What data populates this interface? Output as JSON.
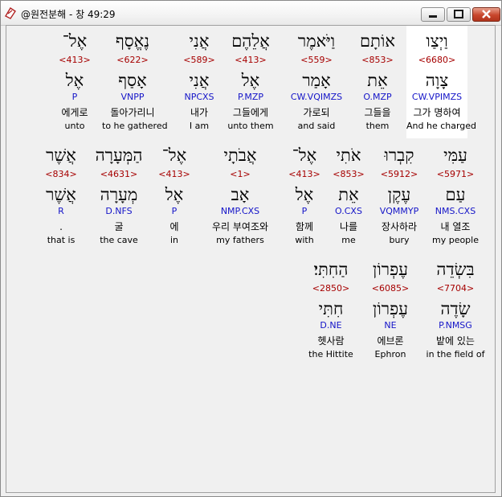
{
  "window": {
    "title": "@원전분해 - 창 49:29",
    "buttons": {
      "minimize": "minimize-icon",
      "maximize": "maximize-icon",
      "close": "close-icon"
    },
    "close_color": "#c8462c"
  },
  "colors": {
    "strongs": "#a60000",
    "parsing": "#1414c8",
    "selected_bg": "#ffffff",
    "panel_bg": "#f0f0f0"
  },
  "rows": [
    {
      "words": [
        {
          "hebrew": "וַיְצַו",
          "strongs": "<6680>",
          "lemma": "צָוָה",
          "parse": "CW.VPIMZS",
          "korean": "그가 명하여",
          "english": "And he charged",
          "selected": true
        },
        {
          "hebrew": "אוֹתָם",
          "strongs": "<853>",
          "lemma": "אֵת",
          "parse": "O.MZP",
          "korean": "그들을",
          "english": "them"
        },
        {
          "hebrew": "וַיֹּאמֶר",
          "strongs": "<559>",
          "lemma": "אָמַר",
          "parse": "CW.VQIMZS",
          "korean": "가로되",
          "english": "and said"
        },
        {
          "hebrew": "אֲלֵהֶם",
          "strongs": "<413>",
          "lemma": "אֶל",
          "parse": "P.MZP",
          "korean": "그들에게",
          "english": "unto them"
        },
        {
          "hebrew": "אֲנִי",
          "strongs": "<589>",
          "lemma": "אֲנִי",
          "parse": "NPCXS",
          "korean": "내가",
          "english": "I am"
        },
        {
          "hebrew": "נֶאֱסָף",
          "strongs": "<622>",
          "lemma": "אָסַף",
          "parse": "VNPP",
          "korean": "돌아가리니",
          "english": "to he gathered"
        },
        {
          "hebrew": "אֶל־",
          "strongs": "<413>",
          "lemma": "אֶל",
          "parse": "P",
          "korean": "에게로",
          "english": "unto"
        }
      ]
    },
    {
      "words": [
        {
          "hebrew": "עַמִּי",
          "strongs": "<5971>",
          "lemma": "עַם",
          "parse": "NMS.CXS",
          "korean": "내 열조",
          "english": "my people"
        },
        {
          "hebrew": "קִבְרוּ",
          "strongs": "<5912>",
          "lemma": "עֶקֶן",
          "parse": "VQMMYP",
          "korean": "장사하라",
          "english": "bury"
        },
        {
          "hebrew": "אֹתִי",
          "strongs": "<853>",
          "lemma": "אֵת",
          "parse": "O.CXS",
          "korean": "나를",
          "english": "me"
        },
        {
          "hebrew": "אֶל־",
          "strongs": "<413>",
          "lemma": "אֶל",
          "parse": "P",
          "korean": "함께",
          "english": "with"
        },
        {
          "hebrew": "אֲבֹתָי",
          "strongs": "<1>",
          "lemma": "אָב",
          "parse": "NMP.CXS",
          "korean": "우리 부여조와",
          "english": "my fathers"
        },
        {
          "hebrew": "אֶל־",
          "strongs": "<413>",
          "lemma": "אֶל",
          "parse": "P",
          "korean": "에",
          "english": "in"
        },
        {
          "hebrew": "הַמְּעָרָה",
          "strongs": "<4631>",
          "lemma": "מְעָרָה",
          "parse": "D.NFS",
          "korean": "굴",
          "english": "the cave"
        },
        {
          "hebrew": "אֲשֶׁר",
          "strongs": "<834>",
          "lemma": "אֲשֶׁר",
          "parse": "R",
          "korean": ".",
          "english": "that is"
        }
      ]
    },
    {
      "words": [
        {
          "hebrew": "בִּשְׂדֵה",
          "strongs": "<7704>",
          "lemma": "שָׂדֶה",
          "parse": "P.NMSG",
          "korean": "밭에 있는",
          "english": "in the field of"
        },
        {
          "hebrew": "עֶפְרוֹן",
          "strongs": "<6085>",
          "lemma": "עֶפְרוֹן",
          "parse": "NE",
          "korean": "에브론",
          "english": "Ephron"
        },
        {
          "hebrew": "הַחִתִּי׃",
          "strongs": "<2850>",
          "lemma": "חִתִּי",
          "parse": "D.NE",
          "korean": "헷사람",
          "english": "the Hittite"
        }
      ]
    }
  ]
}
